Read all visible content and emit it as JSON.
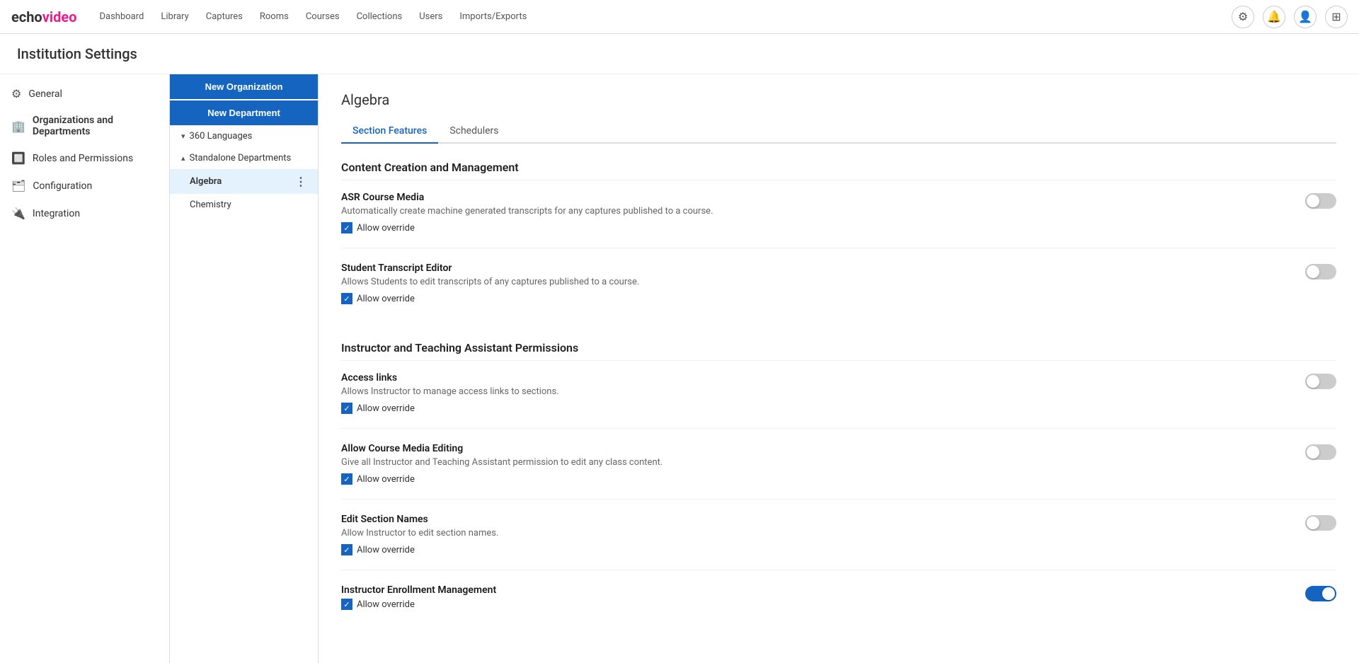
{
  "app": {
    "logo_echo": "echo",
    "logo_video": "video"
  },
  "nav": {
    "links": [
      {
        "label": "Dashboard",
        "id": "dashboard"
      },
      {
        "label": "Library",
        "id": "library"
      },
      {
        "label": "Captures",
        "id": "captures"
      },
      {
        "label": "Rooms",
        "id": "rooms"
      },
      {
        "label": "Courses",
        "id": "courses"
      },
      {
        "label": "Collections",
        "id": "collections"
      },
      {
        "label": "Users",
        "id": "users"
      },
      {
        "label": "Imports/Exports",
        "id": "imports-exports"
      }
    ]
  },
  "page": {
    "title": "Institution Settings"
  },
  "sidebar": {
    "items": [
      {
        "label": "General",
        "icon": "⚙",
        "id": "general"
      },
      {
        "label": "Organizations and Departments",
        "icon": "🏢",
        "id": "orgs"
      },
      {
        "label": "Roles and Permissions",
        "icon": "🔲",
        "id": "roles"
      },
      {
        "label": "Configuration",
        "icon": "🗂",
        "id": "config"
      },
      {
        "label": "Integration",
        "icon": "🔌",
        "id": "integration"
      }
    ]
  },
  "middle_panel": {
    "btn_new_org": "New Organization",
    "btn_new_dept": "New Department",
    "tree": [
      {
        "label": "360 Languages",
        "id": "360-languages",
        "expanded": false,
        "chevron": "▾"
      },
      {
        "label": "Standalone Departments",
        "id": "standalone-departments",
        "expanded": true,
        "chevron": "▴",
        "children": [
          {
            "label": "Algebra",
            "id": "algebra",
            "selected": true
          },
          {
            "label": "Chemistry",
            "id": "chemistry",
            "selected": false
          }
        ]
      }
    ]
  },
  "main": {
    "section_title": "Algebra",
    "tabs": [
      {
        "label": "Section Features",
        "id": "section-features",
        "active": true
      },
      {
        "label": "Schedulers",
        "id": "schedulers",
        "active": false
      }
    ],
    "feature_sections": [
      {
        "id": "content-creation",
        "title": "Content Creation and Management",
        "items": [
          {
            "id": "asr-course-media",
            "name": "ASR Course Media",
            "description": "Automatically create machine generated transcripts for any captures published to a course.",
            "allow_override": true,
            "allow_override_label": "Allow override",
            "toggle_on": false
          },
          {
            "id": "student-transcript-editor",
            "name": "Student Transcript Editor",
            "description": "Allows Students to edit transcripts of any captures published to a course.",
            "allow_override": true,
            "allow_override_label": "Allow override",
            "toggle_on": false
          }
        ]
      },
      {
        "id": "instructor-permissions",
        "title": "Instructor and Teaching Assistant Permissions",
        "items": [
          {
            "id": "access-links",
            "name": "Access links",
            "description": "Allows Instructor to manage access links to sections.",
            "allow_override": true,
            "allow_override_label": "Allow override",
            "toggle_on": false
          },
          {
            "id": "allow-course-media-editing",
            "name": "Allow Course Media Editing",
            "description": "Give all Instructor and Teaching Assistant permission to edit any class content.",
            "allow_override": true,
            "allow_override_label": "Allow override",
            "toggle_on": false
          },
          {
            "id": "edit-section-names",
            "name": "Edit Section Names",
            "description": "Allow Instructor to edit section names.",
            "allow_override": true,
            "allow_override_label": "Allow override",
            "toggle_on": false
          },
          {
            "id": "instructor-enrollment-management",
            "name": "Instructor Enrollment Management",
            "description": "",
            "allow_override": true,
            "allow_override_label": "Allow override",
            "toggle_on": true
          }
        ]
      }
    ]
  }
}
